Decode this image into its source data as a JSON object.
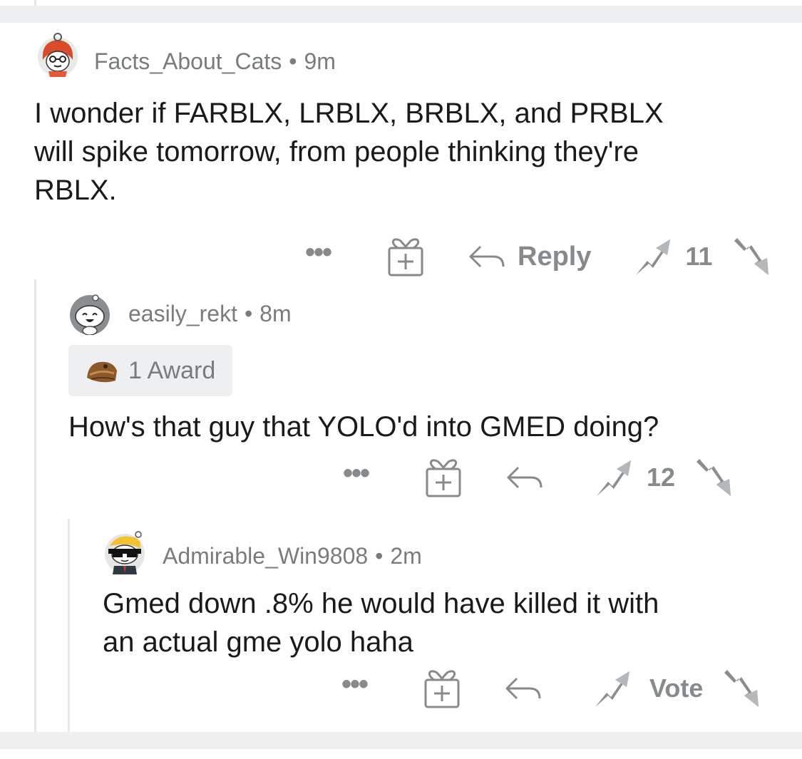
{
  "comments": [
    {
      "author": "Facts_About_Cats",
      "separator": "•",
      "time": "9m",
      "body": "I wonder if FARBLX, LRBLX, BRBLX, and PRBLX\nwill spike tomorrow, from people thinking they're\nRBLX.",
      "more": "•••",
      "reply_label": "Reply",
      "score": "11"
    },
    {
      "author": "easily_rekt",
      "separator": "•",
      "time": "8m",
      "award": "1 Award",
      "body": "How's that guy that YOLO'd into GMED doing?",
      "more": "•••",
      "score": "12"
    },
    {
      "author": "Admirable_Win9808",
      "separator": "•",
      "time": "2m",
      "body": "Gmed down .8% he would have killed it with\nan actual gme yolo haha",
      "more": "•••",
      "score": "Vote"
    }
  ],
  "icons": {
    "more": "more-options-icon",
    "gift": "give-award-icon",
    "reply": "reply-arrow-icon",
    "upvote": "upvote-arrow-icon",
    "downvote": "downvote-arrow-icon"
  },
  "colors": {
    "text": "#1a1a1b",
    "meta": "#787c7e",
    "action": "#878a8c",
    "band": "#edeff1",
    "thread": "#e4e6e8"
  }
}
